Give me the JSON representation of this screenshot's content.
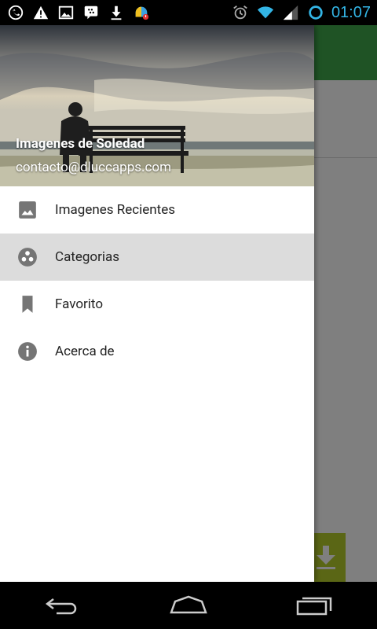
{
  "status_bar": {
    "time": "01:07",
    "left_icons": [
      "whatsapp-icon",
      "warning-icon",
      "image-icon",
      "bbm-icon",
      "download-icon",
      "app-update-icon"
    ],
    "right_icons": [
      "alarm-icon",
      "wifi-icon",
      "signal-icon",
      "sync-icon"
    ]
  },
  "drawer": {
    "header": {
      "title": "Imagenes de Soledad",
      "email": "contacto@dluccapps.com"
    },
    "items": [
      {
        "label": "Imagenes Recientes",
        "icon": "image-icon",
        "active": false
      },
      {
        "label": "Categorias",
        "icon": "categories-icon",
        "active": true
      },
      {
        "label": "Favorito",
        "icon": "bookmark-icon",
        "active": false
      },
      {
        "label": "Acerca de",
        "icon": "info-icon",
        "active": false
      }
    ]
  },
  "colors": {
    "toolbar": "#3fa64a",
    "fab": "#b4cc2a",
    "active_item": "#dcdcdc",
    "clock": "#33b5e5"
  },
  "nav_bar": {
    "buttons": [
      "back-icon",
      "home-icon",
      "recents-icon"
    ]
  }
}
